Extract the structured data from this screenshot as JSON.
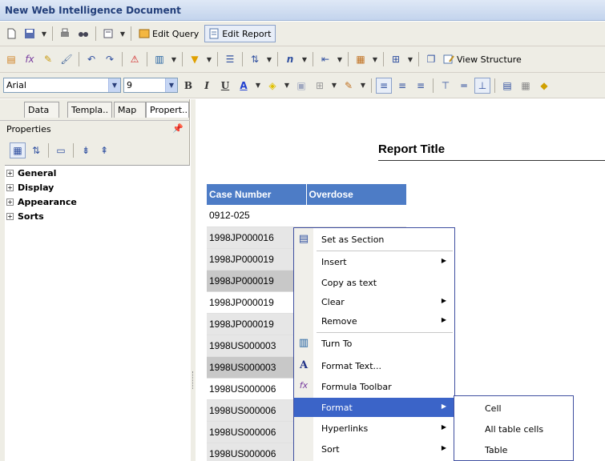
{
  "window": {
    "title": "New Web Intelligence Document"
  },
  "toolbar1": {
    "edit_query": "Edit Query",
    "edit_report": "Edit Report"
  },
  "toolbar2": {
    "view_structure": "View Structure"
  },
  "formatbar": {
    "font": "Arial",
    "size": "9"
  },
  "left_panel": {
    "tabs": [
      "Data",
      "Templa..",
      "Map",
      "Propert.."
    ],
    "header": "Properties",
    "groups": [
      "General",
      "Display",
      "Appearance",
      "Sorts"
    ]
  },
  "report": {
    "title": "Report Title",
    "columns": [
      "Case Number",
      "Overdose"
    ],
    "rows": [
      {
        "case": "0912-025",
        "overdose": ""
      },
      {
        "case": "1998JP000016",
        "overdose": ""
      },
      {
        "case": "1998JP000019",
        "overdose": ""
      },
      {
        "case": "1998JP000019",
        "overdose": ""
      },
      {
        "case": "1998JP000019",
        "overdose": ""
      },
      {
        "case": "1998JP000019",
        "overdose": ""
      },
      {
        "case": "1998US000003",
        "overdose": ""
      },
      {
        "case": "1998US000003",
        "overdose": ""
      },
      {
        "case": "1998US000006",
        "overdose": ""
      },
      {
        "case": "1998US000006",
        "overdose": ""
      },
      {
        "case": "1998US000006",
        "overdose": ""
      },
      {
        "case": "1998US000006",
        "overdose": ""
      }
    ]
  },
  "context_menu": {
    "items": [
      "Set as Section",
      "Insert",
      "Copy as text",
      "Clear",
      "Remove",
      "Turn To",
      "Format Text...",
      "Formula Toolbar",
      "Format",
      "Hyperlinks",
      "Sort"
    ],
    "highlighted": "Format"
  },
  "format_submenu": {
    "items": [
      "Cell",
      "All table cells",
      "Table"
    ]
  },
  "colors": {
    "title_text": "#233f7a",
    "table_header": "#4d7cc6",
    "menu_highlight": "#3b64c8",
    "menu_border": "#3f4fa0"
  }
}
